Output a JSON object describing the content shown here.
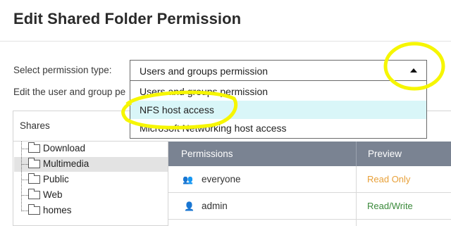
{
  "dialog": {
    "title": "Edit Shared Folder Permission"
  },
  "form": {
    "permission_type_label": "Select permission type:",
    "edit_label": "Edit the user and group pe",
    "select": {
      "value": "Users and groups permission",
      "options": [
        "Users and groups permission",
        "NFS host access",
        "Microsoft Networking host access"
      ],
      "highlighted_index": 1
    }
  },
  "shares": {
    "header": "Shares",
    "items": [
      {
        "label": "Download"
      },
      {
        "label": "Multimedia"
      },
      {
        "label": "Public"
      },
      {
        "label": "Web"
      },
      {
        "label": "homes"
      }
    ],
    "selected_index": 1
  },
  "permissions_table": {
    "columns": [
      "Permissions",
      "Preview"
    ],
    "rows": [
      {
        "icon": "group-icon",
        "name": "everyone",
        "preview": "Read Only",
        "preview_color": "#e8a13a"
      },
      {
        "icon": "user-icon",
        "name": "admin",
        "preview": "Read/Write",
        "preview_color": "#3b8a3b"
      }
    ]
  },
  "colors": {
    "header_bg": "#7a8392",
    "highlight_option": "#d9f6f8",
    "annotation": "#f6f600"
  }
}
